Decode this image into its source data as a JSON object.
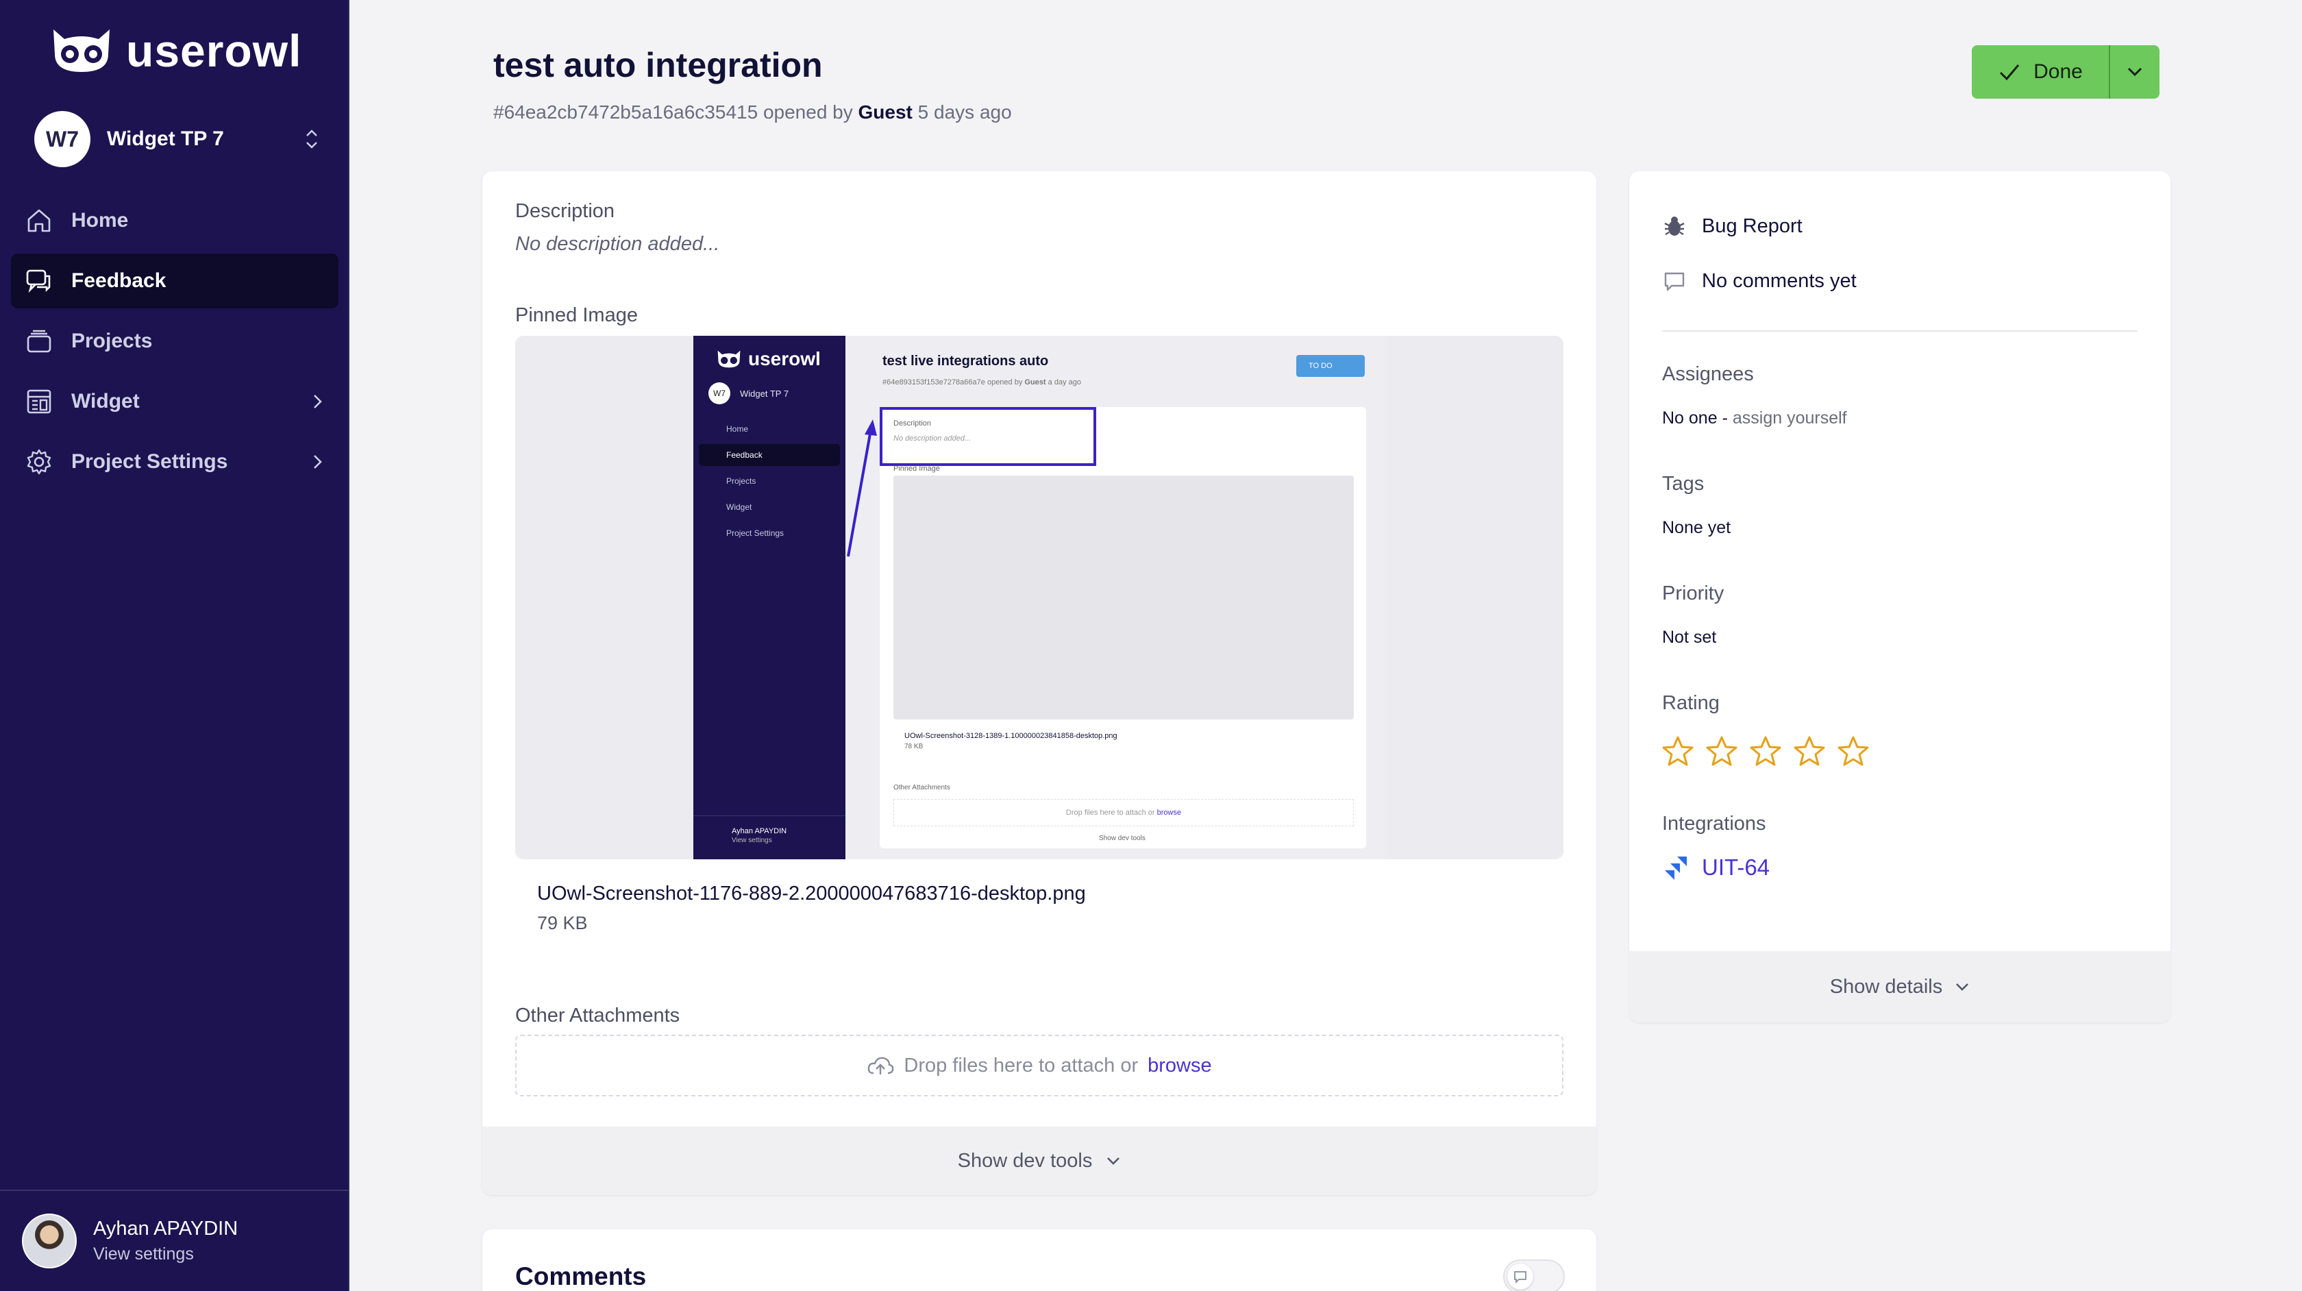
{
  "app": {
    "brand": "userowl"
  },
  "sidebar": {
    "workspace": {
      "initials": "W7",
      "name": "Widget TP 7"
    },
    "items": [
      {
        "label": "Home"
      },
      {
        "label": "Feedback"
      },
      {
        "label": "Projects"
      },
      {
        "label": "Widget"
      },
      {
        "label": "Project Settings"
      }
    ],
    "user": {
      "name": "Ayhan APAYDIN",
      "sub": "View settings"
    }
  },
  "header": {
    "title": "test auto integration",
    "id": "#64ea2cb7472b5a16a6c35415",
    "opened_by_text": "opened by",
    "author": "Guest",
    "time": "5 days ago",
    "done_label": "Done"
  },
  "main": {
    "description_label": "Description",
    "description_placeholder": "No description added...",
    "pinned_label": "Pinned Image",
    "file_name": "UOwl-Screenshot-1176-889-2.200000047683716-desktop.png",
    "file_size": "79 KB",
    "attachments_label": "Other Attachments",
    "drop_text": "Drop files here to attach or",
    "drop_link": "browse",
    "dev_tools": "Show dev tools"
  },
  "mini": {
    "brand": "userowl",
    "ws_initials": "W7",
    "ws_name": "Widget TP 7",
    "nav": [
      "Home",
      "Feedback",
      "Projects",
      "Widget",
      "Project Settings"
    ],
    "title": "test live integrations auto",
    "sub_id": "#64e893153f153e7278a66a7e",
    "sub_opened": "opened by",
    "sub_author": "Guest",
    "sub_time": "a day ago",
    "status": "TO DO",
    "desc_label": "Description",
    "desc_placeholder": "No description added...",
    "pinned_label": "Pinned Image",
    "file_name": "UOwl-Screenshot-3128-1389-1.100000023841858-desktop.png",
    "file_size": "78 KB",
    "attachments_label": "Other Attachments",
    "drop_text": "Drop files here to attach or",
    "drop_link": "browse",
    "dev_tools": "Show dev tools",
    "user_name": "Ayhan APAYDIN",
    "user_sub": "View settings"
  },
  "details": {
    "type": "Bug Report",
    "comments": "No comments yet",
    "assignees_label": "Assignees",
    "assignees_value": "No one",
    "assign_link": "assign yourself",
    "tags_label": "Tags",
    "tags_value": "None yet",
    "priority_label": "Priority",
    "priority_value": "Not set",
    "rating_label": "Rating",
    "rating_value": 0,
    "rating_max": 5,
    "integrations_label": "Integrations",
    "integration_key": "UIT-64",
    "show_details": "Show details"
  },
  "comments": {
    "title": "Comments"
  },
  "colors": {
    "sidebar": "#1c1350",
    "accent": "#4a32d4",
    "done": "#6dc95b",
    "star": "#e4a11b"
  }
}
